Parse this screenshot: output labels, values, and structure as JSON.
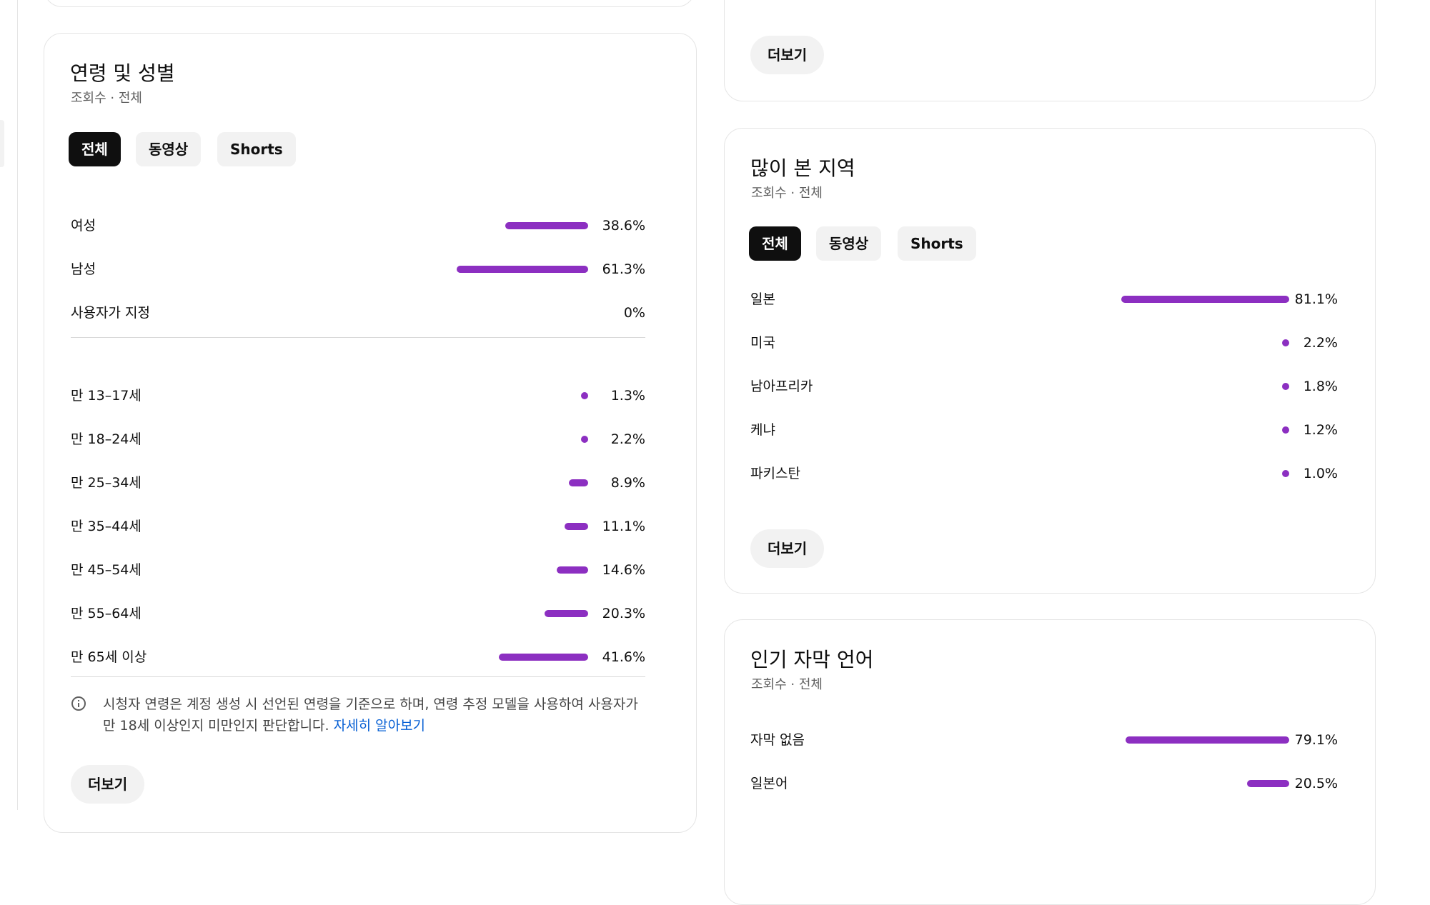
{
  "age_gender": {
    "title": "연령 및 성별",
    "subtitle": "조회수 · 전체",
    "tabs": [
      {
        "label": "전체",
        "active": true
      },
      {
        "label": "동영상",
        "active": false
      },
      {
        "label": "Shorts",
        "active": false
      }
    ],
    "gender_rows": [
      {
        "label": "여성",
        "value": "38.6%",
        "percent": 38.6
      },
      {
        "label": "남성",
        "value": "61.3%",
        "percent": 61.3
      },
      {
        "label": "사용자가 지정",
        "value": "0%",
        "percent": 0
      }
    ],
    "age_rows": [
      {
        "label": "만 13–17세",
        "value": "1.3%",
        "percent": 1.3
      },
      {
        "label": "만 18–24세",
        "value": "2.2%",
        "percent": 2.2
      },
      {
        "label": "만 25–34세",
        "value": "8.9%",
        "percent": 8.9
      },
      {
        "label": "만 35–44세",
        "value": "11.1%",
        "percent": 11.1
      },
      {
        "label": "만 45–54세",
        "value": "14.6%",
        "percent": 14.6
      },
      {
        "label": "만 55–64세",
        "value": "20.3%",
        "percent": 20.3
      },
      {
        "label": "만 65세 이상",
        "value": "41.6%",
        "percent": 41.6
      }
    ],
    "note_text": "시청자 연령은 계정 생성 시 선언된 연령을 기준으로 하며, 연령 추정 모델을 사용하여 사용자가 만 18세 이상인지 미만인지 판단합니다.",
    "note_link": "자세히 알아보기",
    "more_label": "더보기"
  },
  "top_card": {
    "more_label": "더보기"
  },
  "regions": {
    "title": "많이 본 지역",
    "subtitle": "조회수 · 전체",
    "tabs": [
      {
        "label": "전체",
        "active": true
      },
      {
        "label": "동영상",
        "active": false
      },
      {
        "label": "Shorts",
        "active": false
      }
    ],
    "rows": [
      {
        "label": "일본",
        "value": "81.1%",
        "percent": 81.1
      },
      {
        "label": "미국",
        "value": "2.2%",
        "percent": 2.2
      },
      {
        "label": "남아프리카",
        "value": "1.8%",
        "percent": 1.8
      },
      {
        "label": "케냐",
        "value": "1.2%",
        "percent": 1.2
      },
      {
        "label": "파키스탄",
        "value": "1.0%",
        "percent": 1.0
      }
    ],
    "more_label": "더보기"
  },
  "subtitles": {
    "title": "인기 자막 언어",
    "subtitle": "조회수 · 전체",
    "rows": [
      {
        "label": "자막 없음",
        "value": "79.1%",
        "percent": 79.1
      },
      {
        "label": "일본어",
        "value": "20.5%",
        "percent": 20.5
      }
    ]
  },
  "colors": {
    "bar": "#8c2fc1",
    "link": "#065fd4",
    "chip_active": "#0f0f0f"
  }
}
